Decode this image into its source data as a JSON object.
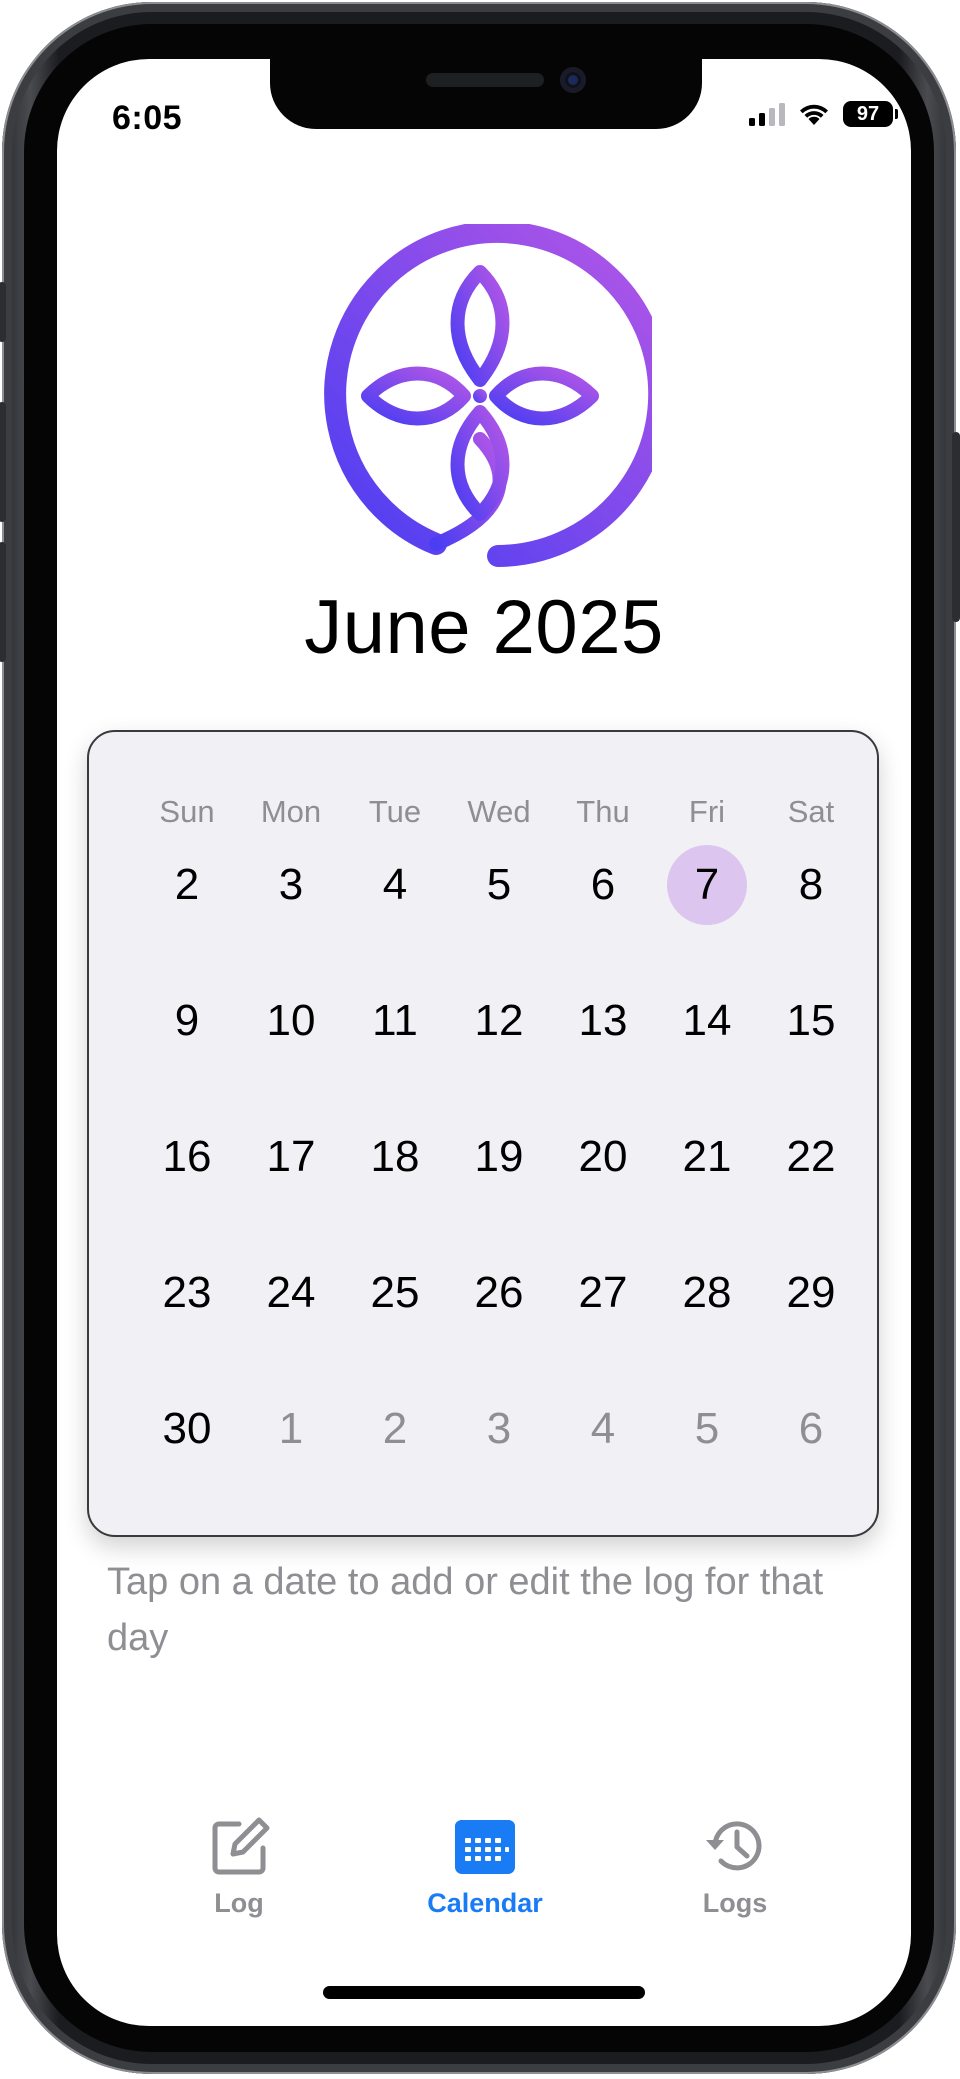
{
  "status_bar": {
    "time": "6:05",
    "battery": "97"
  },
  "header": {
    "month_title": "June 2025"
  },
  "calendar": {
    "weekdays": [
      "Sun",
      "Mon",
      "Tue",
      "Wed",
      "Thu",
      "Fri",
      "Sat"
    ],
    "weeks": [
      [
        {
          "d": "2",
          "cur": true
        },
        {
          "d": "3",
          "cur": true
        },
        {
          "d": "4",
          "cur": true
        },
        {
          "d": "5",
          "cur": true
        },
        {
          "d": "6",
          "cur": true
        },
        {
          "d": "7",
          "cur": true,
          "selected": true
        },
        {
          "d": "8",
          "cur": true
        }
      ],
      [
        {
          "d": "9",
          "cur": true
        },
        {
          "d": "10",
          "cur": true
        },
        {
          "d": "11",
          "cur": true
        },
        {
          "d": "12",
          "cur": true
        },
        {
          "d": "13",
          "cur": true
        },
        {
          "d": "14",
          "cur": true
        },
        {
          "d": "15",
          "cur": true
        }
      ],
      [
        {
          "d": "16",
          "cur": true
        },
        {
          "d": "17",
          "cur": true
        },
        {
          "d": "18",
          "cur": true
        },
        {
          "d": "19",
          "cur": true
        },
        {
          "d": "20",
          "cur": true
        },
        {
          "d": "21",
          "cur": true
        },
        {
          "d": "22",
          "cur": true
        }
      ],
      [
        {
          "d": "23",
          "cur": true
        },
        {
          "d": "24",
          "cur": true
        },
        {
          "d": "25",
          "cur": true
        },
        {
          "d": "26",
          "cur": true
        },
        {
          "d": "27",
          "cur": true
        },
        {
          "d": "28",
          "cur": true
        },
        {
          "d": "29",
          "cur": true
        }
      ],
      [
        {
          "d": "30",
          "cur": true
        },
        {
          "d": "1",
          "cur": false
        },
        {
          "d": "2",
          "cur": false
        },
        {
          "d": "3",
          "cur": false
        },
        {
          "d": "4",
          "cur": false
        },
        {
          "d": "5",
          "cur": false
        },
        {
          "d": "6",
          "cur": false
        }
      ]
    ],
    "selected_color": "#dcc5ef"
  },
  "hint": {
    "text": "Tap on a date to add or edit the log for that day"
  },
  "tab_bar": {
    "tabs": [
      {
        "label": "Log",
        "icon": "edit-icon",
        "active": false
      },
      {
        "label": "Calendar",
        "icon": "calendar-icon",
        "active": true
      },
      {
        "label": "Logs",
        "icon": "history-icon",
        "active": false
      }
    ],
    "active_color": "#1a7cf5",
    "inactive_color": "#8e8e93"
  },
  "theme": {
    "logo_gradient": [
      "#4a3df2",
      "#b457e6"
    ]
  }
}
